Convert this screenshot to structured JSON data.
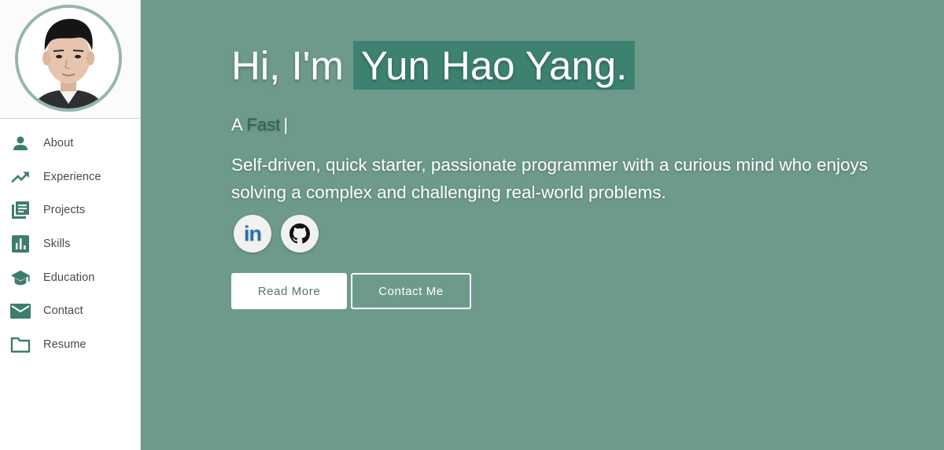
{
  "sidebar": {
    "items": [
      {
        "label": "About",
        "icon": "person-icon"
      },
      {
        "label": "Experience",
        "icon": "trending-up-icon"
      },
      {
        "label": "Projects",
        "icon": "projects-icon"
      },
      {
        "label": "Skills",
        "icon": "bar-chart-icon"
      },
      {
        "label": "Education",
        "icon": "graduation-cap-icon"
      },
      {
        "label": "Contact",
        "icon": "mail-icon"
      },
      {
        "label": "Resume",
        "icon": "folder-icon"
      }
    ]
  },
  "hero": {
    "greeting": "Hi, I'm",
    "name": "Yun Hao Yang.",
    "typed_prefix": "A",
    "typed_word": "Fast",
    "typed_cursor": "|",
    "tagline": "Self-driven, quick starter, passionate programmer with a curious mind who enjoys solving a complex and challenging real-world problems."
  },
  "social": {
    "linkedin_text": "in",
    "linkedin_icon": "linkedin-icon",
    "github_icon": "github-icon"
  },
  "buttons": {
    "read_more": "Read More",
    "contact_me": "Contact Me"
  },
  "colors": {
    "background": "#6e9a8c",
    "accent": "#3d8270",
    "sidebar_icon": "#3e7d6d"
  }
}
